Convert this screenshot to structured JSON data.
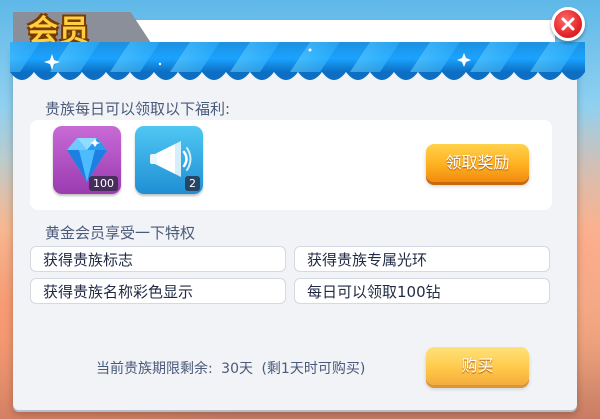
{
  "header": {
    "title": "会员",
    "close_icon": "close-icon"
  },
  "daily": {
    "label": "贵族每日可以领取以下福利:",
    "items": [
      {
        "name": "diamond",
        "icon": "diamond-icon",
        "count": "100"
      },
      {
        "name": "horn",
        "icon": "horn-icon",
        "count": "2"
      }
    ],
    "claim_label": "领取奖励"
  },
  "gold": {
    "label": "黄金会员享受一下特权",
    "privileges": [
      "获得贵族标志",
      "获得贵族专属光环",
      "获得贵族名称彩色显示",
      "每日可以领取100钻"
    ]
  },
  "footer": {
    "expiry_label": "当前贵族期限剩余:",
    "expiry_value": "30天",
    "expiry_note": "(剩1天时可购买)",
    "buy_label": "购买"
  },
  "colors": {
    "accent_orange": "#ffb020",
    "close_red": "#e5262a",
    "title_gold": "#ffcf3f"
  }
}
